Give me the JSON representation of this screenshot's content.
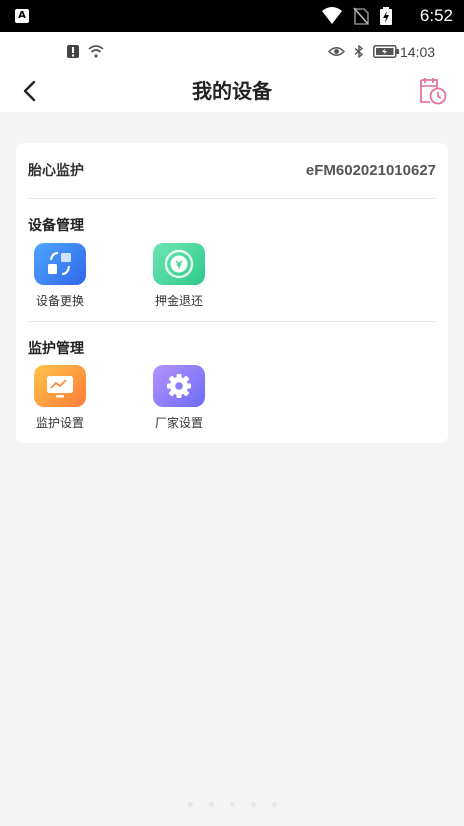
{
  "system_status": {
    "clock": "6:52",
    "app_badge": "A",
    "icons": [
      "wifi-icon",
      "no-sim-icon",
      "battery-charging-icon"
    ]
  },
  "device_status": {
    "time": "14:03",
    "left_icons": [
      "alert-icon",
      "wifi-icon"
    ],
    "right_icons": [
      "eye-icon",
      "bluetooth-icon",
      "battery-icon"
    ]
  },
  "nav": {
    "title": "我的设备",
    "back_icon": "chevron-left-icon",
    "history_icon": "history-icon"
  },
  "monitor": {
    "label": "胎心监护",
    "device_id": "eFM602021010627"
  },
  "sections": [
    {
      "title": "设备管理",
      "items": [
        {
          "label": "设备更换",
          "icon": "swap-device-icon",
          "color": "#3f86f4"
        },
        {
          "label": "押金退还",
          "icon": "deposit-refund-icon",
          "color": "#3fd59b"
        }
      ]
    },
    {
      "title": "监护管理",
      "items": [
        {
          "label": "监护设置",
          "icon": "monitor-settings-icon",
          "color": "#ff9a3c"
        },
        {
          "label": "厂家设置",
          "icon": "gear-icon",
          "color": "#8a7df5"
        }
      ]
    }
  ]
}
